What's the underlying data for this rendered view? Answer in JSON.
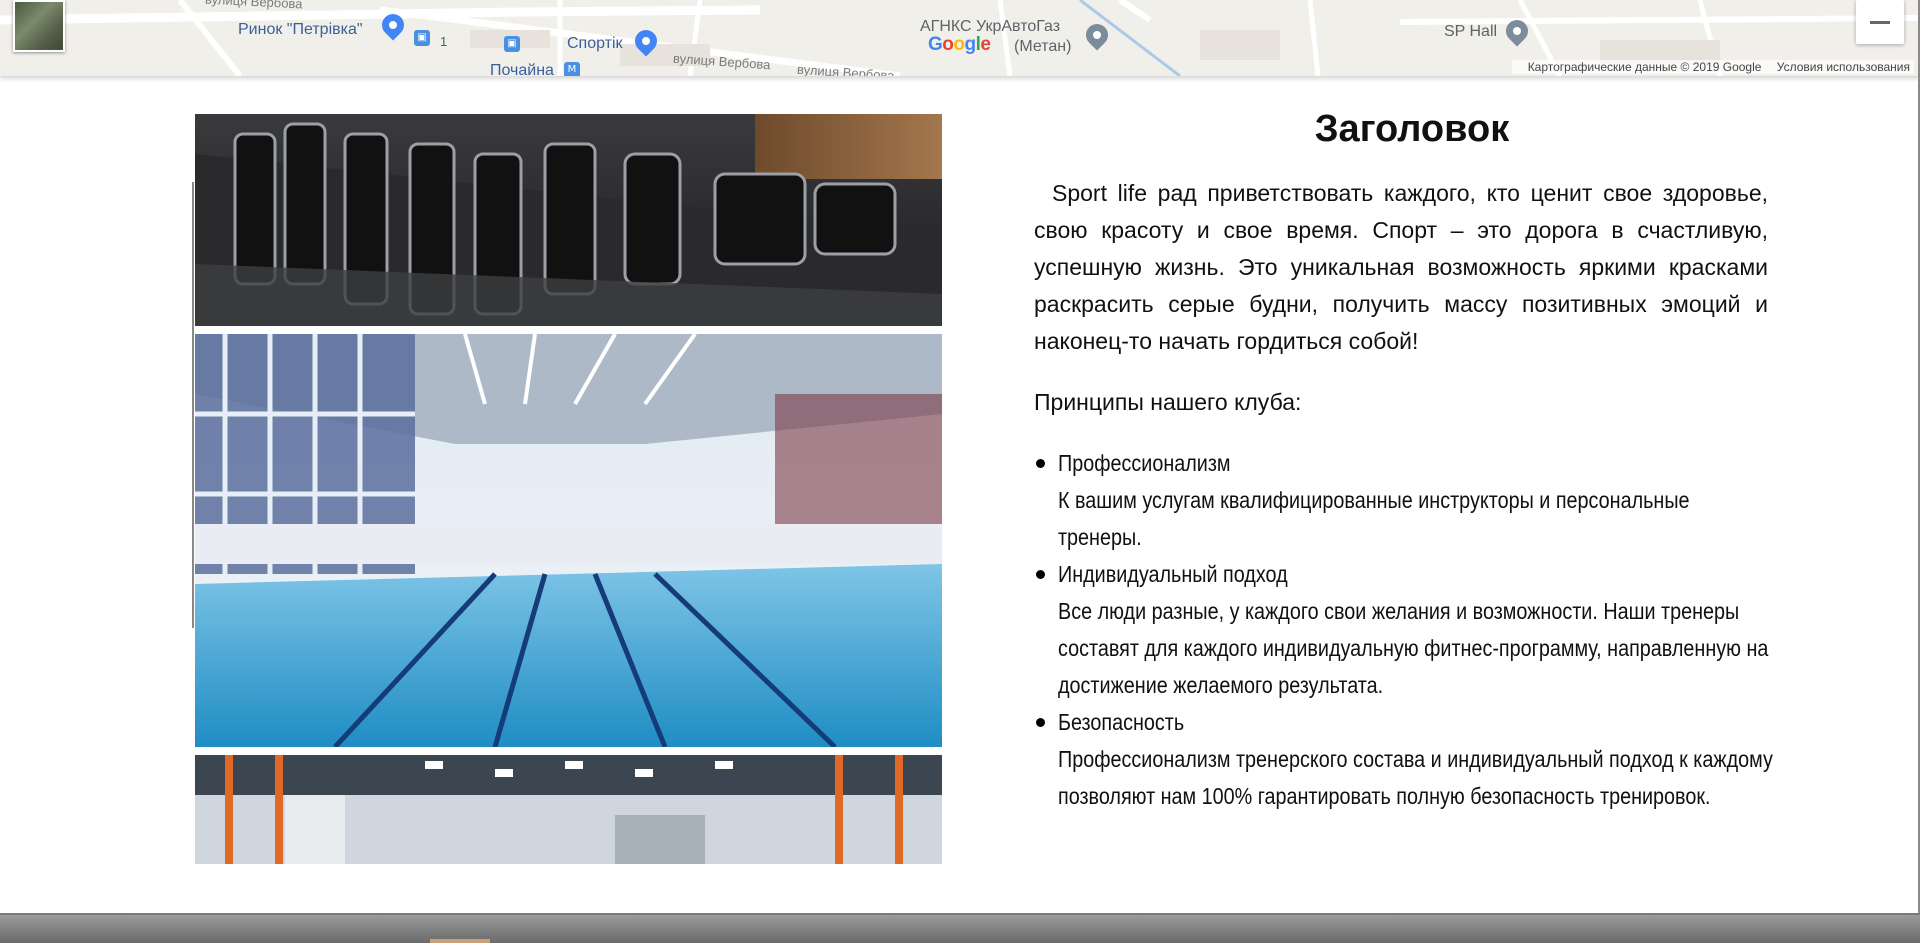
{
  "map": {
    "labels": {
      "top_left_street": "вулиця Вербова",
      "market": "Ринок \"Петрівка\"",
      "tram": "1",
      "sport": "Спортік",
      "street_mid": "вулиця Вербова",
      "street_right": "вулиця Вербова",
      "metro": "Почайна",
      "gas_station_line1": "АГНКС УкрАвтоГаз",
      "gas_station_line2": "(Метан)",
      "sp_hall": "SP Hall"
    },
    "google_logo": [
      "G",
      "o",
      "o",
      "g",
      "l",
      "e"
    ],
    "footer": {
      "copyright": "Картографические данные © 2019 Google",
      "terms": "Условия использования"
    },
    "controls": {
      "thumbnail_icon": "satellite-thumbnail",
      "zoom_out_icon": "minus-icon"
    }
  },
  "gallery": {
    "photos": [
      {
        "subject": "gym-cardio-machines"
      },
      {
        "subject": "indoor-swimming-pool"
      },
      {
        "subject": "gym-hall-ceiling-lights"
      }
    ],
    "next_icon": "chevron-right-icon",
    "next_glyph": "›"
  },
  "content": {
    "title": "Заголовок",
    "intro": "Sport life рад приветствовать каждого, кто ценит свое здоровье, свою красоту и свое время. Спорт – это дорога в счастливую, успешную жизнь. Это уникальная возможность яркими красками раскрасить серые будни, получить массу позитивных эмоций и наконец-то начать гордиться собой!",
    "principles_heading": "Принципы нашего клуба:",
    "principles": [
      {
        "name": "Профессионализм",
        "lines": [
          "К вашим услугам квалифицированные инструкторы и персональные",
          "тренеры."
        ]
      },
      {
        "name": "Индивидуальный подход",
        "lines": [
          "Все люди разные, у каждого свои желания и возможности. Наши тренеры",
          "составят для каждого индивидуальную фитнес-программу, направленную на",
          "достижение желаемого результата."
        ]
      },
      {
        "name": "Безопасность",
        "lines": [
          "Профессионализм тренерского состава и индивидуальный подход к каждому",
          "позволяют нам 100% гарантировать полную безопасность тренировок."
        ]
      }
    ]
  }
}
